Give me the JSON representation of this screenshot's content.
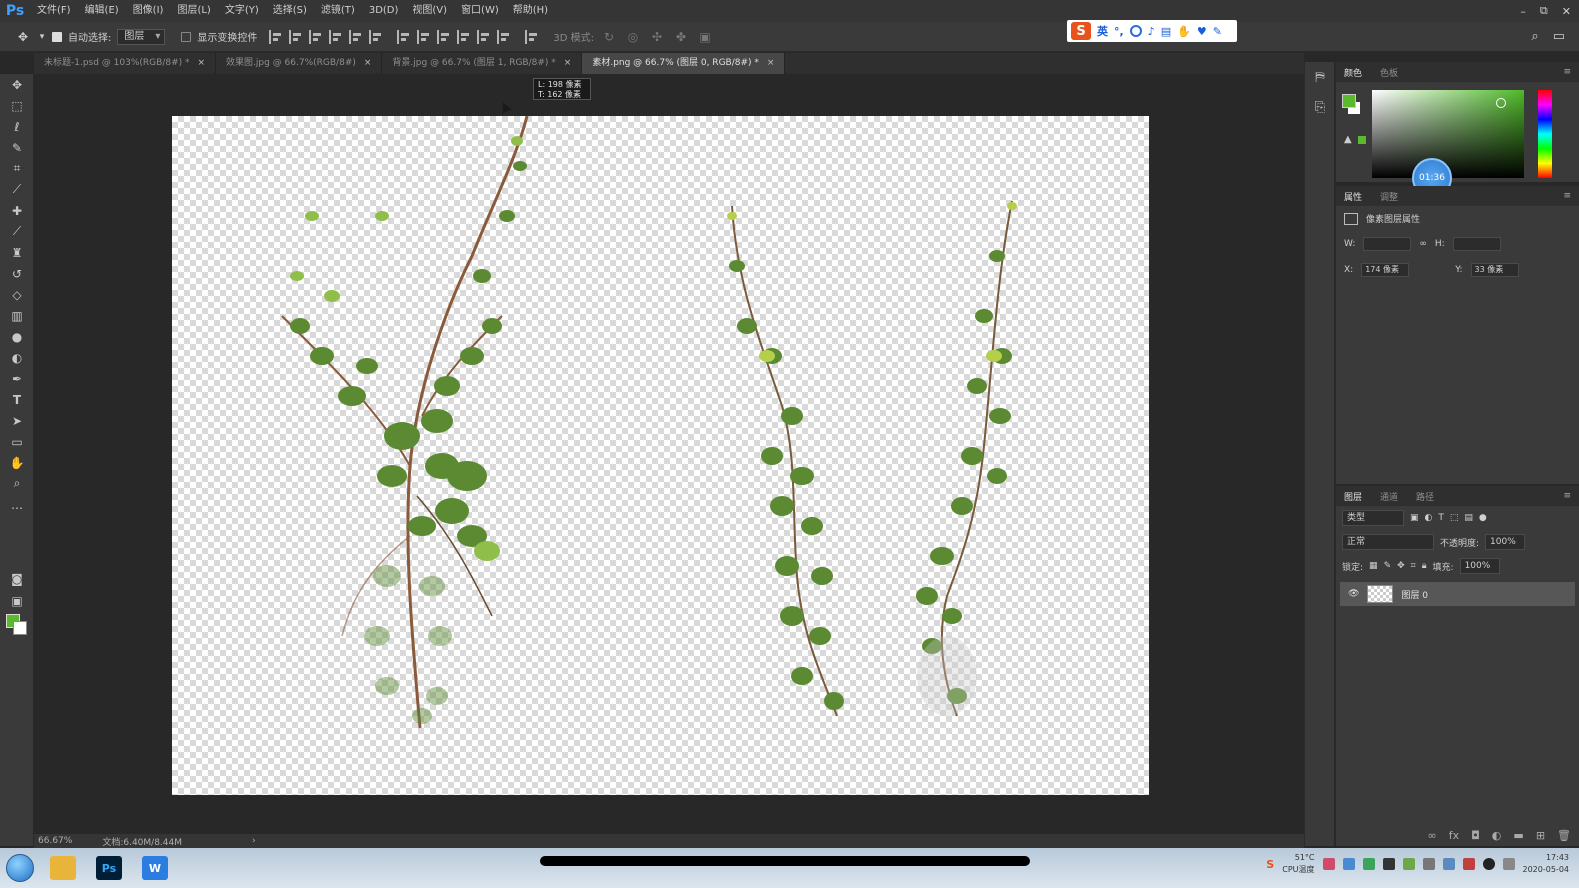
{
  "app": {
    "logo": "Ps"
  },
  "menu": [
    "文件(F)",
    "编辑(E)",
    "图像(I)",
    "图层(L)",
    "文字(Y)",
    "选择(S)",
    "滤镜(T)",
    "3D(D)",
    "视图(V)",
    "窗口(W)",
    "帮助(H)"
  ],
  "window_controls": {
    "minimize": "–",
    "restore": "⧉",
    "close": "✕"
  },
  "options": {
    "auto_select_label": "自动选择:",
    "auto_select_value": "图层",
    "show_transform_label": "显示变换控件",
    "mode3d_label": "3D 模式:"
  },
  "ime": {
    "brand": "S",
    "lang": "英"
  },
  "tabs": [
    {
      "label": "未标题-1.psd @ 103%(RGB/8#) *",
      "active": false
    },
    {
      "label": "效果图.jpg @ 66.7%(RGB/8#)",
      "active": false
    },
    {
      "label": "背景.jpg @ 66.7% (图层 1, RGB/8#) *",
      "active": false
    },
    {
      "label": "素材.png @ 66.7% (图层 0, RGB/8#) *",
      "active": true
    }
  ],
  "tooltip": {
    "line1": "L: 198 像素",
    "line2": "T: 162 像素"
  },
  "status": {
    "zoom": "66.67%",
    "doc": "文档:6.40M/8.44M"
  },
  "color_panel": {
    "tabs": [
      "颜色",
      "色板"
    ],
    "timer": "01:36"
  },
  "properties_panel": {
    "tabs": [
      "属性",
      "调整"
    ],
    "title": "像素图层属性",
    "w_label": "W:",
    "h_label": "H:",
    "x_label": "X:",
    "x_value": "174 像素",
    "y_label": "Y:",
    "y_value": "33 像素"
  },
  "layers_panel": {
    "tabs": [
      "图层",
      "通道",
      "路径"
    ],
    "kind_label": "类型",
    "blend_mode": "正常",
    "opacity_label": "不透明度:",
    "opacity_value": "100%",
    "lock_label": "锁定:",
    "fill_label": "填充:",
    "fill_value": "100%",
    "layer_name": "图层 0"
  },
  "taskbar": {
    "apps": [
      {
        "name": "explorer",
        "color": "#e8b53a",
        "glyph": ""
      },
      {
        "name": "photoshop",
        "color": "#001e36",
        "glyph": "Ps"
      },
      {
        "name": "w-app",
        "color": "#2b7de0",
        "glyph": "W"
      }
    ],
    "temp": "51°C",
    "cpu_label": "CPU温度",
    "time": "17:43",
    "date": "2020-05-04"
  },
  "colors": {
    "foreground": "#5bb92d",
    "background": "#ffffff",
    "ps_blue": "#3fa0ff",
    "leaf_dark": "#4e7f2a",
    "leaf_light": "#8fbf4a",
    "stem": "#8a5a3c"
  }
}
